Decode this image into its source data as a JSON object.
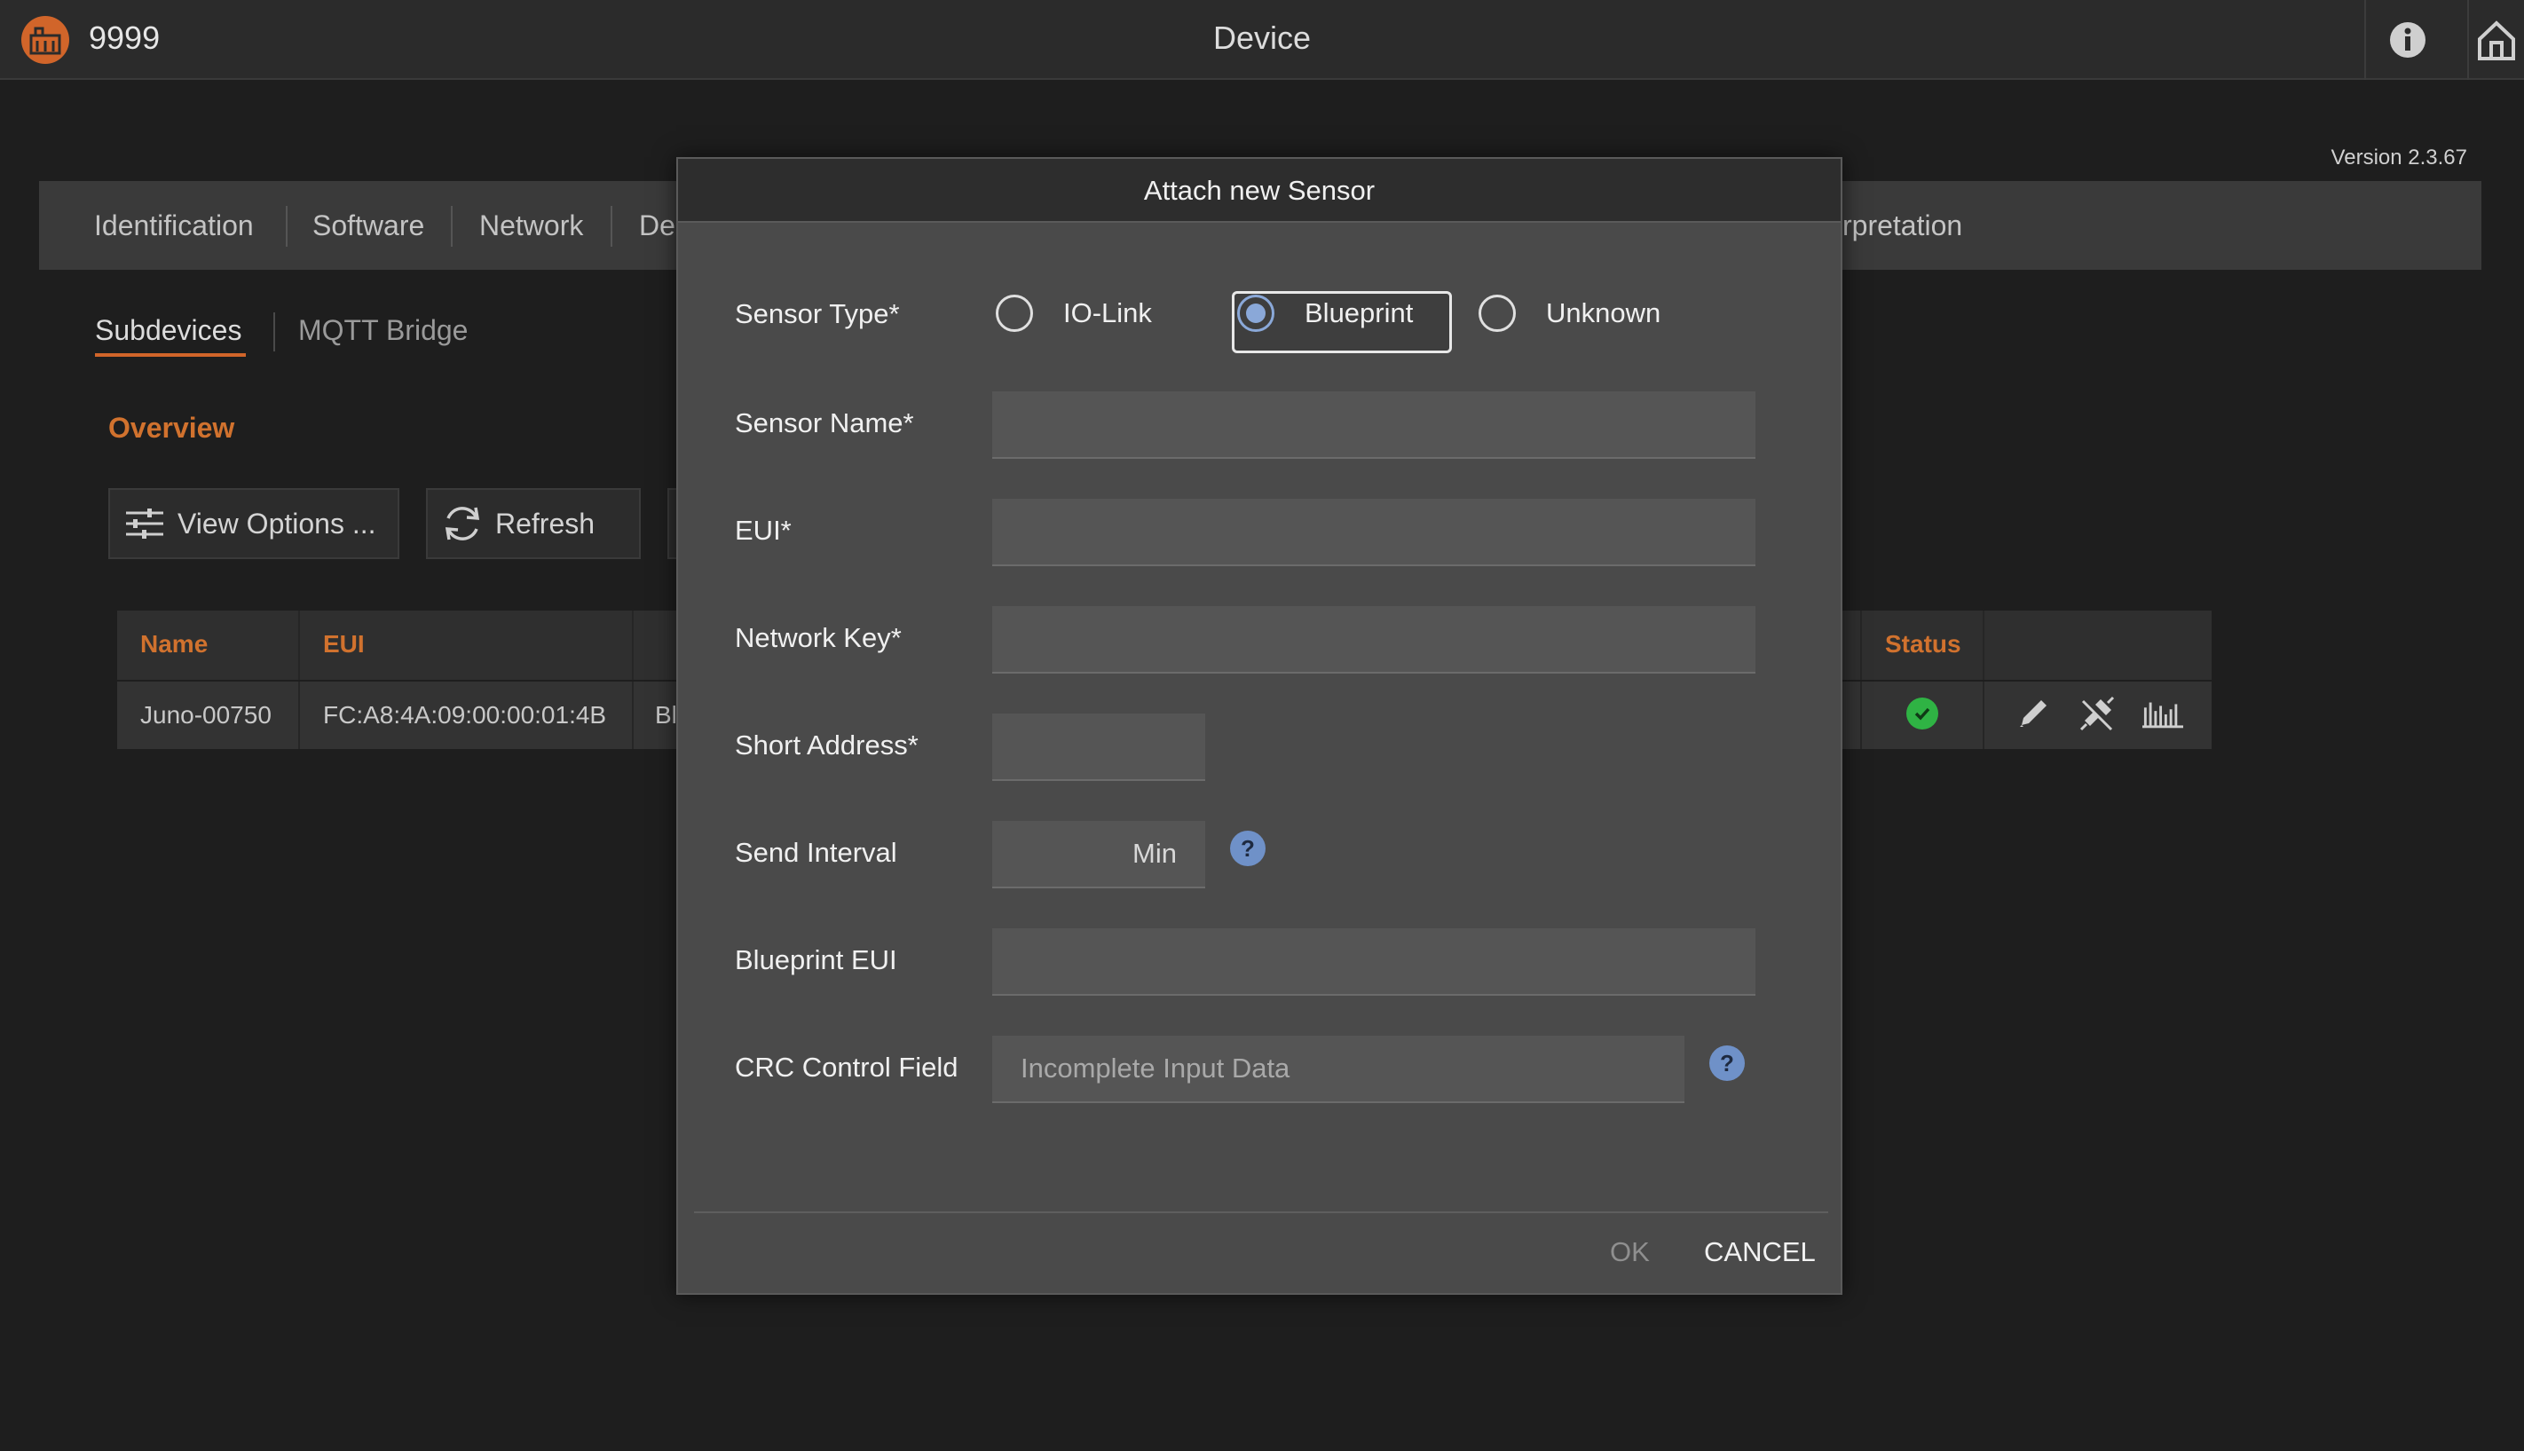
{
  "header": {
    "device_id": "9999",
    "title": "Device",
    "version": "Version 2.3.67"
  },
  "main_tabs": [
    "Identification",
    "Software",
    "Network",
    "De",
    "rpretation"
  ],
  "sub_tabs": [
    "Subdevices",
    "MQTT Bridge"
  ],
  "section_title": "Overview",
  "toolbar": {
    "view_options": "View Options ...",
    "refresh": "Refresh"
  },
  "table": {
    "columns": [
      "Name",
      "EUI",
      "Status"
    ],
    "rows": [
      {
        "name": "Juno-00750",
        "eui": "FC:A8:4A:09:00:00:01:4B",
        "type": "Bl"
      }
    ]
  },
  "dialog": {
    "title": "Attach new Sensor",
    "sensor_type_label": "Sensor Type*",
    "sensor_type_options": [
      "IO-Link",
      "Blueprint",
      "Unknown"
    ],
    "sensor_type_selected": "Blueprint",
    "sensor_name_label": "Sensor Name*",
    "sensor_name_value": "",
    "eui_label": "EUI*",
    "eui_value": "",
    "network_key_label": "Network Key*",
    "network_key_value": "",
    "short_address_label": "Short Address*",
    "short_address_value": "",
    "send_interval_label": "Send Interval",
    "send_interval_unit": "Min",
    "blueprint_eui_label": "Blueprint EUI",
    "blueprint_eui_value": "",
    "crc_label": "CRC Control Field",
    "crc_value": "Incomplete Input Data",
    "help_glyph": "?",
    "ok": "OK",
    "cancel": "CANCEL"
  },
  "colors": {
    "accent": "#d1722e",
    "radio_selected": "#8aa8d8",
    "status_ok": "#2fb344",
    "help": "#6f91c8"
  },
  "icons": [
    "brand-logo",
    "info-icon",
    "home-icon",
    "sliders-icon",
    "refresh-icon",
    "check-icon",
    "pencil-icon",
    "detach-icon",
    "chart-icon",
    "help-icon"
  ]
}
